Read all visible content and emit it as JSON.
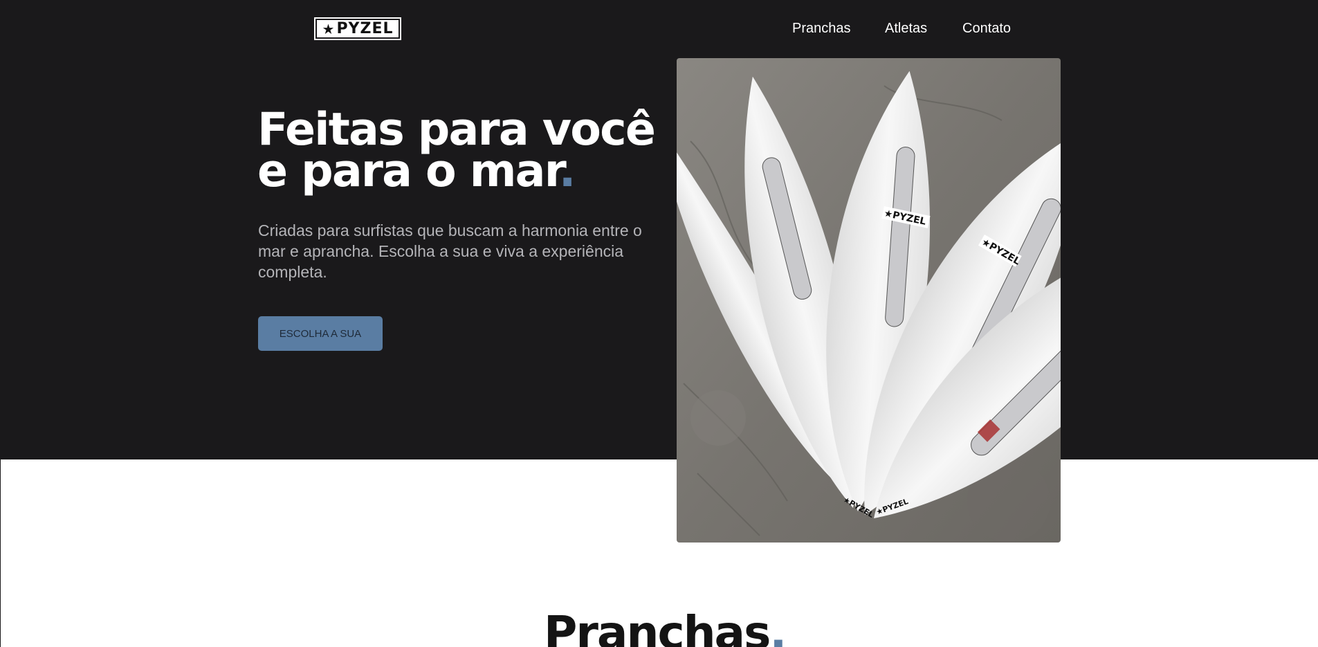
{
  "brand": {
    "logo_text": "PYZEL",
    "logo_icon": "star-icon"
  },
  "nav": {
    "items": [
      {
        "label": "Pranchas"
      },
      {
        "label": "Atletas"
      },
      {
        "label": "Contato"
      }
    ]
  },
  "hero": {
    "title_line1": "Feitas para você",
    "title_line2": "e para o mar",
    "title_dot": ".",
    "subtitle": "Criadas para surfistas que buscam a harmonia entre o mar e aprancha. Escolha a sua e viva a experiência completa.",
    "cta_label": "ESCOLHA A SUA",
    "image_logo_text": "★PYZEL"
  },
  "boards_section": {
    "title": "Pranchas",
    "title_dot": "."
  },
  "colors": {
    "background_dark": "#1a191b",
    "accent": "#5a7da3",
    "text_light": "#ffffff",
    "text_muted": "#b4b4b8"
  }
}
